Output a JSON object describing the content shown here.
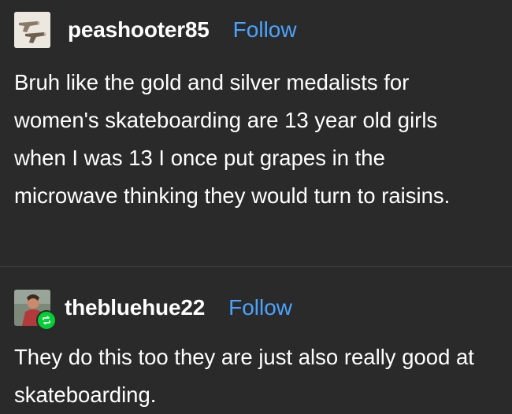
{
  "posts": [
    {
      "username": "peashooter85",
      "follow_label": "Follow",
      "avatar_icon": "antique-pistols-avatar",
      "body": "Bruh like the gold and silver medalists for women's skateboarding are 13 year old girls when I was 13 I once put grapes in the microwave thinking they would turn to raisins."
    },
    {
      "username": "thebluehue22",
      "follow_label": "Follow",
      "avatar_icon": "person-photo-avatar",
      "badge_icon": "reblog-icon",
      "body": "They do this too they are just also really good at skateboarding."
    }
  ],
  "colors": {
    "background": "#2a2a2a",
    "text": "#ffffff",
    "follow": "#4aa3ff",
    "reblog_badge": "#00cf35"
  }
}
